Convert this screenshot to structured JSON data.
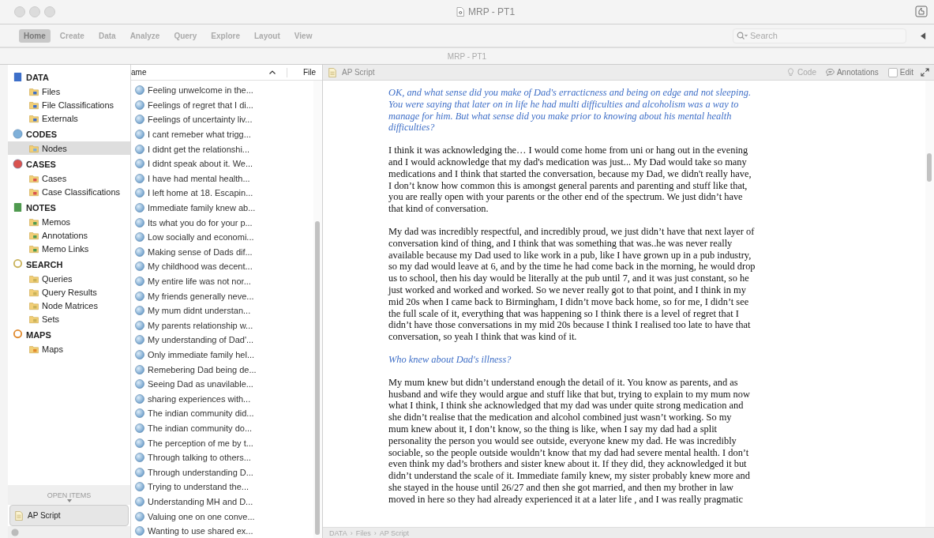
{
  "window": {
    "title": "MRP - PT1",
    "subtitle": "MRP - PT1"
  },
  "ribbon_tabs": [
    {
      "label": "Home",
      "selected": true
    },
    {
      "label": "Create",
      "selected": false
    },
    {
      "label": "Data",
      "selected": false
    },
    {
      "label": "Analyze",
      "selected": false
    },
    {
      "label": "Query",
      "selected": false
    },
    {
      "label": "Explore",
      "selected": false
    },
    {
      "label": "Layout",
      "selected": false
    },
    {
      "label": "View",
      "selected": false
    }
  ],
  "search": {
    "placeholder": "Search"
  },
  "sidebar": {
    "sections": [
      {
        "label": "DATA",
        "kind": "data",
        "items": [
          {
            "label": "Files",
            "selected": false
          },
          {
            "label": "File Classifications",
            "selected": false
          },
          {
            "label": "Externals",
            "selected": false
          }
        ]
      },
      {
        "label": "CODES",
        "kind": "codes",
        "items": [
          {
            "label": "Nodes",
            "selected": true
          }
        ]
      },
      {
        "label": "CASES",
        "kind": "cases",
        "items": [
          {
            "label": "Cases",
            "selected": false
          },
          {
            "label": "Case Classifications",
            "selected": false
          }
        ]
      },
      {
        "label": "NOTES",
        "kind": "notes",
        "items": [
          {
            "label": "Memos",
            "selected": false
          },
          {
            "label": "Annotations",
            "selected": false
          },
          {
            "label": "Memo Links",
            "selected": false
          }
        ]
      },
      {
        "label": "SEARCH",
        "kind": "search",
        "items": [
          {
            "label": "Queries",
            "selected": false
          },
          {
            "label": "Query Results",
            "selected": false
          },
          {
            "label": "Node Matrices",
            "selected": false
          },
          {
            "label": "Sets",
            "selected": false
          }
        ]
      },
      {
        "label": "MAPS",
        "kind": "maps",
        "items": [
          {
            "label": "Maps",
            "selected": false
          }
        ]
      }
    ],
    "open_items_label": "OPEN ITEMS",
    "open_items": [
      "AP Script"
    ]
  },
  "node_list": {
    "columns": [
      "ame",
      "File"
    ],
    "rows": [
      "Feeling unwelcome in the...",
      "Feelings of regret that I di...",
      "Feelings of uncertainty liv...",
      "I cant remeber what trigg...",
      "I didnt get the relationshi...",
      "I didnt speak about it. We...",
      "I have had mental health...",
      "I left home at 18.  Escapin...",
      "Immediate family knew ab...",
      "Its what you do for your p...",
      "Low socially and economi...",
      "Making sense of Dads dif...",
      "My childhood was decent...",
      "My entire life was not nor...",
      "My friends generally neve...",
      "My mum didnt understan...",
      "My parents relationship w...",
      "My understanding of Dad'...",
      "Only immediate family hel...",
      "Remebering Dad being de...",
      "Seeing Dad as unavilable...",
      "sharing experiences with...",
      "The indian community did...",
      "The indian community do...",
      "The perception of me by t...",
      "Through talking to others...",
      "Through understanding D...",
      "Trying to understand the...",
      "Understanding MH and D...",
      "Valuing one on one conve...",
      "Wanting to use shared ex..."
    ]
  },
  "document": {
    "title": "AP Script",
    "code_button": {
      "label": "Code",
      "disabled": true
    },
    "annotations_button": "Annotations",
    "edit_checkbox": {
      "label": "Edit",
      "checked": false
    },
    "paragraphs": [
      {
        "kind": "question",
        "lines": [
          "OK, and what sense did you make of Dad's erracticness and being on edge and not sleeping.",
          "You were saying that later on in life he had multi difficulties and alcoholism was a way to",
          "manage for him.  But what sense did you make prior to knowing about his  mental health",
          "difficulties?"
        ]
      },
      {
        "kind": "answer",
        "lines": [
          "I think it was acknowledging the… I would come home from uni or hang out in the evening",
          "and I would acknowledge that my dad's medication was just...  My Dad would take so many",
          "medications and I think that started the conversation, because my Dad, we didn't really have,",
          "I don’t know how common this is amongst general parents and parenting and stuff like that,",
          "you are really open with your parents or the other end of the spectrum.  We just didn’t have",
          "that kind of conversation."
        ]
      },
      {
        "kind": "answer",
        "lines": [
          "My dad was incredibly respectful, and incredibly proud, we just didn’t have that next layer of",
          "conversation kind of thing, and I think that was something that was..he was never really",
          "available because my Dad used to like work in a pub, like I have grown up in a pub industry,",
          "so my dad would leave at 6, and by the time he had come back in the morning, he would drop",
          "us to school, then his day would be literally at the pub until 7, and it was just constant, so he",
          "just worked and worked and worked. So we never really got to that point, and I think in my",
          "mid 20s when I came back to Birmingham, I didn’t move back home, so for me, I didn’t see",
          "the full scale of it, everything that was happening so I think there is a level of regret that I",
          "didn’t have those conversations in my mid 20s because I think I realised too late to have that",
          "conversation, so yeah I think that was kind of it."
        ]
      },
      {
        "kind": "question",
        "lines": [
          "Who knew about Dad's illness?"
        ]
      },
      {
        "kind": "answer",
        "lines": [
          "My mum knew but didn’t understand enough the detail of it.  You know as parents, and as",
          "husband and wife they would argue and stuff like that but, trying to explain to my mum now",
          "what I think, I think she acknowledged that my dad was under quite strong medication and",
          "she didn’t realise that the medication and alcohol combined just wasn’t working.  So my",
          "mum knew about it, I don’t know, so the thing is like, when I say my dad had a split",
          "personality the person you would see outside, everyone knew my dad.  He was incredibly",
          "sociable, so the people outside wouldn’t know that my dad had  severe mental health.  I don’t",
          "even think my dad’s brothers and sister knew about it.  If they did, they acknowledged it but",
          "didn’t understand the scale of it.  Immediate family knew, my sister probably knew more and",
          "she stayed in the house until 26/27 and then she got married, and then my brother in law",
          "moved in here so they had already experienced it at a later life , and I was really pragmatic"
        ]
      }
    ]
  },
  "breadcrumb": {
    "separator": "›",
    "items": [
      "DATA",
      "Files",
      "AP Script"
    ]
  }
}
